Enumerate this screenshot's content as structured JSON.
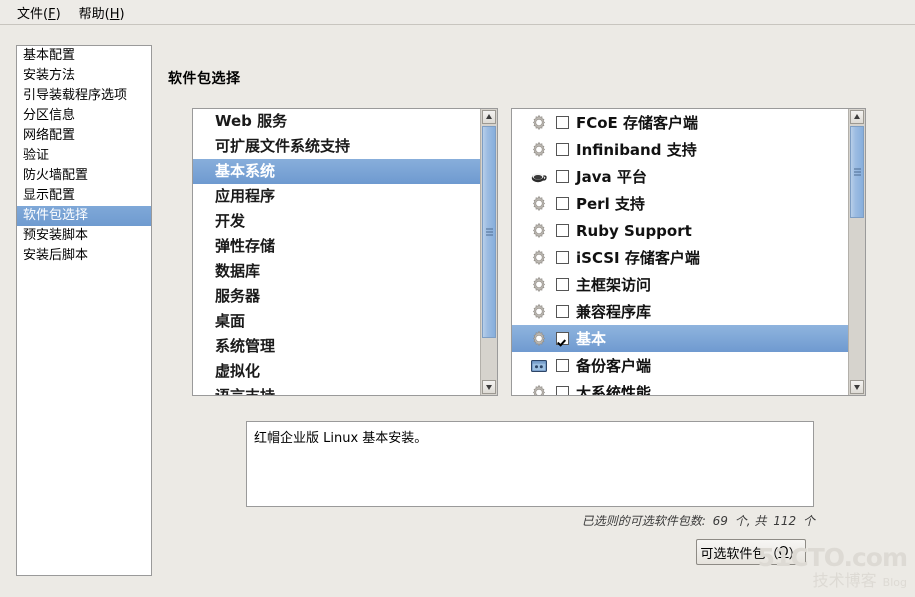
{
  "menubar": {
    "items": [
      {
        "label": "文件",
        "accel": "F"
      },
      {
        "label": "帮助",
        "accel": "H"
      }
    ]
  },
  "sidebar": {
    "items": [
      {
        "label": "基本配置",
        "selected": false
      },
      {
        "label": "安装方法",
        "selected": false
      },
      {
        "label": "引导装载程序选项",
        "selected": false
      },
      {
        "label": "分区信息",
        "selected": false
      },
      {
        "label": "网络配置",
        "selected": false
      },
      {
        "label": "验证",
        "selected": false
      },
      {
        "label": "防火墙配置",
        "selected": false
      },
      {
        "label": "显示配置",
        "selected": false
      },
      {
        "label": "软件包选择",
        "selected": true
      },
      {
        "label": "预安装脚本",
        "selected": false
      },
      {
        "label": "安装后脚本",
        "selected": false
      }
    ]
  },
  "page": {
    "title": "软件包选择"
  },
  "group_list": {
    "items": [
      {
        "label": "Web 服务",
        "selected": false
      },
      {
        "label": "可扩展文件系统支持",
        "selected": false
      },
      {
        "label": "基本系统",
        "selected": true
      },
      {
        "label": "应用程序",
        "selected": false
      },
      {
        "label": "开发",
        "selected": false
      },
      {
        "label": "弹性存储",
        "selected": false
      },
      {
        "label": "数据库",
        "selected": false
      },
      {
        "label": "服务器",
        "selected": false
      },
      {
        "label": "桌面",
        "selected": false
      },
      {
        "label": "系统管理",
        "selected": false
      },
      {
        "label": "虚拟化",
        "selected": false
      },
      {
        "label": "语言支持",
        "selected": false
      }
    ]
  },
  "package_list": {
    "items": [
      {
        "label": "FCoE 存储客户端",
        "icon": "gear-icon",
        "checked": false,
        "selected": false
      },
      {
        "label": "Infiniband 支持",
        "icon": "gear-icon",
        "checked": false,
        "selected": false
      },
      {
        "label": "Java 平台",
        "icon": "coffee-cup-icon",
        "checked": false,
        "selected": false
      },
      {
        "label": "Perl 支持",
        "icon": "gear-icon",
        "checked": false,
        "selected": false
      },
      {
        "label": "Ruby Support",
        "icon": "gear-icon",
        "checked": false,
        "selected": false
      },
      {
        "label": "iSCSI 存储客户端",
        "icon": "gear-icon",
        "checked": false,
        "selected": false
      },
      {
        "label": "主框架访问",
        "icon": "gear-icon",
        "checked": false,
        "selected": false
      },
      {
        "label": "兼容程序库",
        "icon": "gear-icon",
        "checked": false,
        "selected": false
      },
      {
        "label": "基本",
        "icon": "gear-icon",
        "checked": true,
        "selected": true
      },
      {
        "label": "备份客户端",
        "icon": "window-icon",
        "checked": false,
        "selected": false
      },
      {
        "label": "大系统性能",
        "icon": "gear-icon",
        "checked": false,
        "selected": false
      }
    ]
  },
  "description": {
    "text": "红帽企业版 Linux 基本安装。"
  },
  "status": {
    "prefix": "已选则的可选软件包数:",
    "selected_count": "69",
    "unit_1": "个,",
    "total_word": "共",
    "total_count": "112",
    "unit_2": "个"
  },
  "optional_button": {
    "label": "可选软件包（",
    "accel": "O",
    "label_end": "）"
  },
  "watermark": {
    "main": "51CTO.com",
    "sub": "技术博客",
    "blog": "Blog"
  },
  "colors": {
    "selection_blue": "#7ba7d7",
    "background": "#eceae5",
    "panel_white": "#ffffff"
  }
}
